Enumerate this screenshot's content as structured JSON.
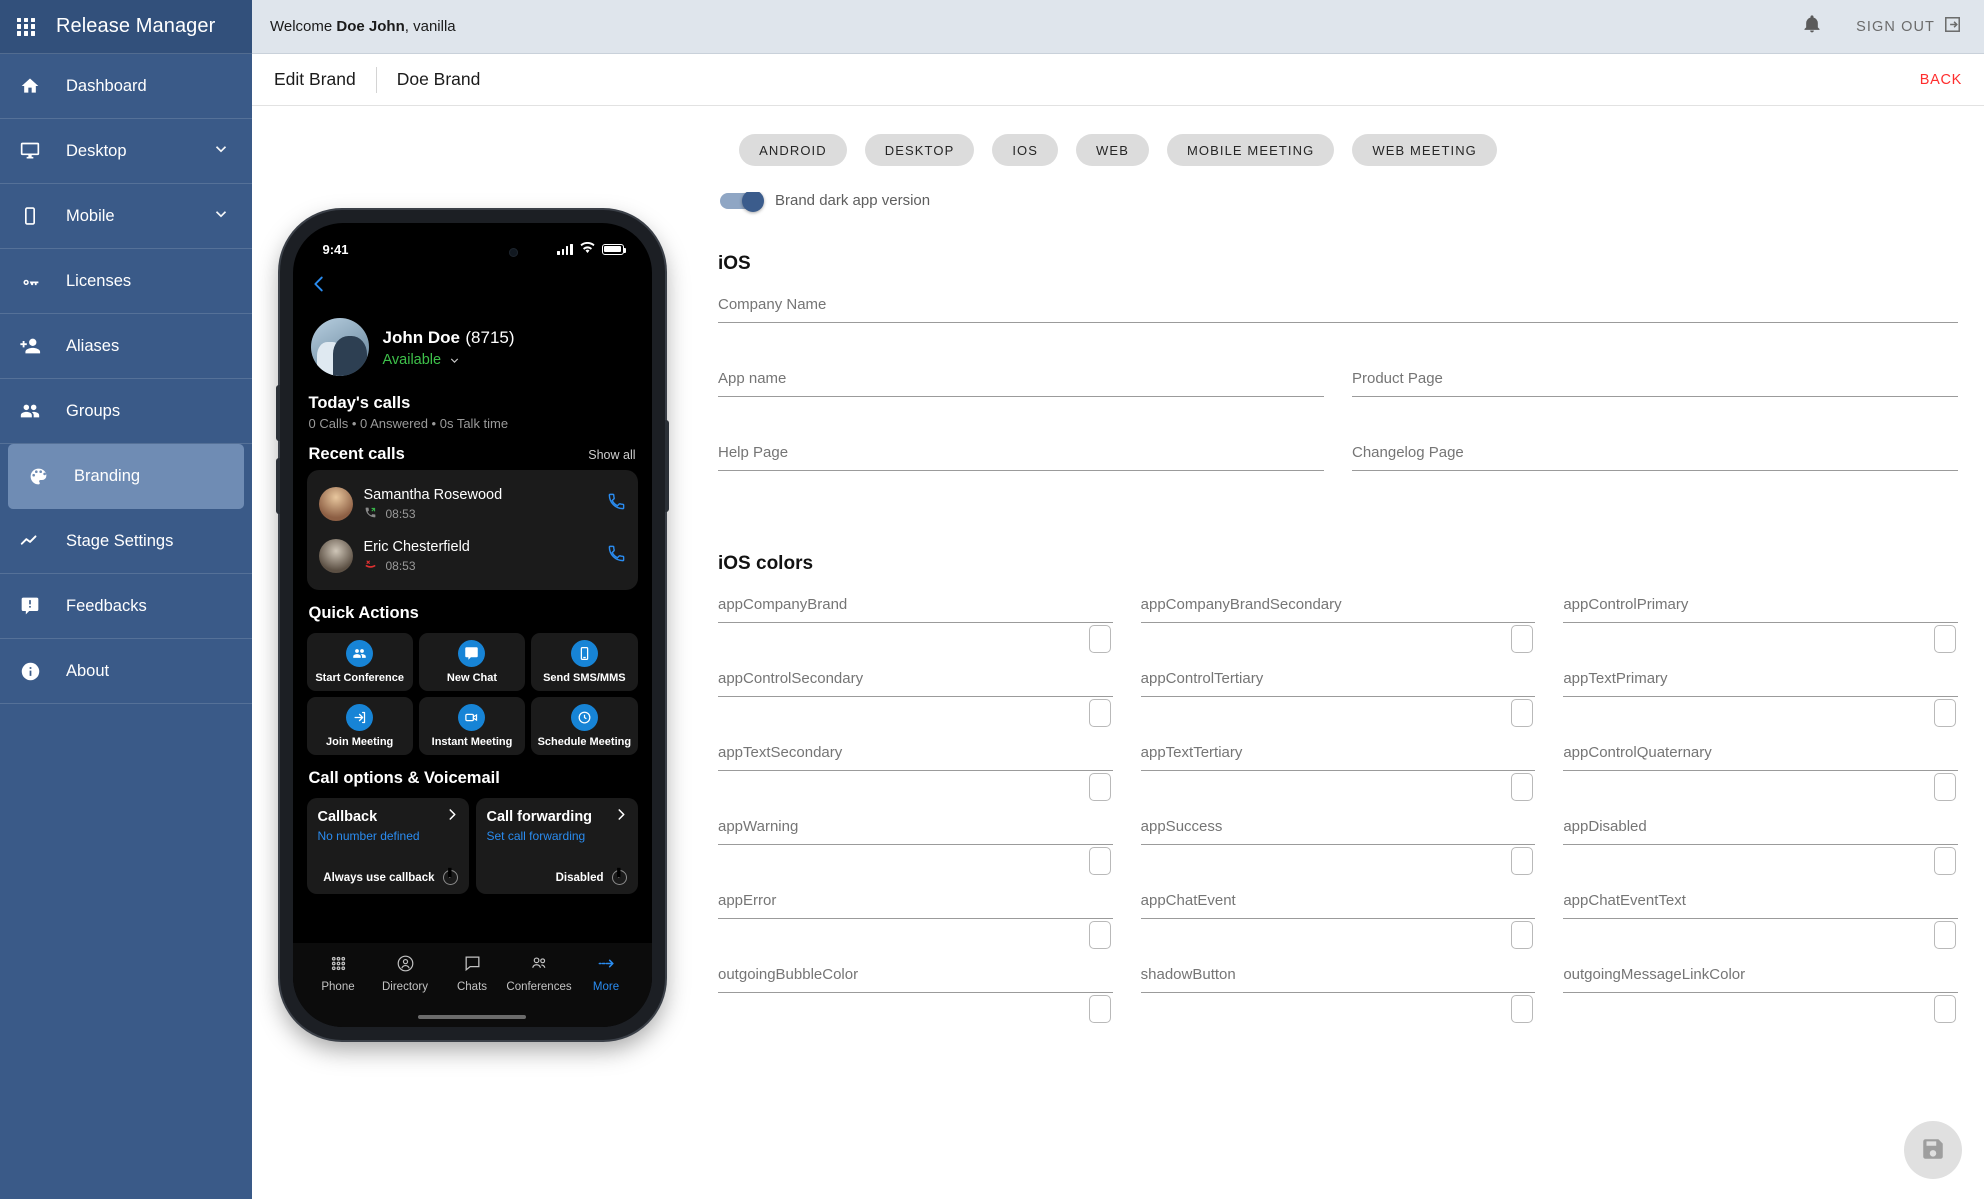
{
  "sidebar": {
    "brand": "Release Manager",
    "items": [
      {
        "label": "Dashboard",
        "icon": "home-icon",
        "chevron": false
      },
      {
        "label": "Desktop",
        "icon": "monitor-icon",
        "chevron": true
      },
      {
        "label": "Mobile",
        "icon": "phone-icon",
        "chevron": true
      },
      {
        "label": "Licenses",
        "icon": "key-icon",
        "chevron": false
      },
      {
        "label": "Aliases",
        "icon": "person-add-icon",
        "chevron": false
      },
      {
        "label": "Groups",
        "icon": "people-icon",
        "chevron": false
      },
      {
        "label": "Branding",
        "icon": "palette-icon",
        "chevron": false
      },
      {
        "label": "Stage Settings",
        "icon": "trending-icon",
        "chevron": false
      },
      {
        "label": "Feedbacks",
        "icon": "feedback-icon",
        "chevron": false
      },
      {
        "label": "About",
        "icon": "info-icon",
        "chevron": false
      }
    ],
    "active": "Branding"
  },
  "topbar": {
    "welcome_prefix": "Welcome",
    "user_name": "Doe John",
    "welcome_suffix": ", vanilla",
    "signout_label": "SIGN OUT"
  },
  "pagehead": {
    "title": "Edit Brand",
    "brand_name": "Doe Brand",
    "back_label": "BACK"
  },
  "tabs": [
    {
      "label": "ANDROID"
    },
    {
      "label": "DESKTOP"
    },
    {
      "label": "IOS"
    },
    {
      "label": "WEB"
    },
    {
      "label": "MOBILE MEETING"
    },
    {
      "label": "WEB MEETING"
    }
  ],
  "form": {
    "dark_toggle_label": "Brand dark app version",
    "dark_toggle_on": true,
    "section_ios": "iOS",
    "section_ios_colors": "iOS colors",
    "text_fields": [
      {
        "placeholder": "Company Name",
        "value": ""
      },
      {
        "placeholder": "App name",
        "value": ""
      },
      {
        "placeholder": "Product Page",
        "value": ""
      },
      {
        "placeholder": "Help Page",
        "value": ""
      },
      {
        "placeholder": "Changelog Page",
        "value": ""
      }
    ],
    "color_fields": [
      {
        "placeholder": "appCompanyBrand",
        "value": ""
      },
      {
        "placeholder": "appCompanyBrandSecondary",
        "value": ""
      },
      {
        "placeholder": "appControlPrimary",
        "value": ""
      },
      {
        "placeholder": "appControlSecondary",
        "value": ""
      },
      {
        "placeholder": "appControlTertiary",
        "value": ""
      },
      {
        "placeholder": "appTextPrimary",
        "value": ""
      },
      {
        "placeholder": "appTextSecondary",
        "value": ""
      },
      {
        "placeholder": "appTextTertiary",
        "value": ""
      },
      {
        "placeholder": "appControlQuaternary",
        "value": ""
      },
      {
        "placeholder": "appWarning",
        "value": ""
      },
      {
        "placeholder": "appSuccess",
        "value": ""
      },
      {
        "placeholder": "appDisabled",
        "value": ""
      },
      {
        "placeholder": "appError",
        "value": ""
      },
      {
        "placeholder": "appChatEvent",
        "value": ""
      },
      {
        "placeholder": "appChatEventText",
        "value": ""
      },
      {
        "placeholder": "outgoingBubbleColor",
        "value": ""
      },
      {
        "placeholder": "shadowButton",
        "value": ""
      },
      {
        "placeholder": "outgoingMessageLinkColor",
        "value": ""
      }
    ],
    "save_icon": "save-floppy-icon"
  },
  "preview": {
    "status_time": "9:41",
    "user_name": "John Doe",
    "user_ext": "(8715)",
    "presence": "Available",
    "todays_calls_title": "Today's calls",
    "todays_calls_sub": "0 Calls • 0 Answered • 0s Talk time",
    "recent_calls_title": "Recent calls",
    "show_all": "Show all",
    "calls": [
      {
        "name": "Samantha Rosewood",
        "time": "08:53",
        "type": "incoming"
      },
      {
        "name": "Eric Chesterfield",
        "time": "08:53",
        "type": "missed"
      }
    ],
    "quick_actions_title": "Quick Actions",
    "quick_actions": [
      {
        "label": "Start Conference",
        "icon": "group-icon"
      },
      {
        "label": "New Chat",
        "icon": "chat-bubble-icon"
      },
      {
        "label": "Send SMS/MMS",
        "icon": "sms-icon"
      },
      {
        "label": "Join Meeting",
        "icon": "login-arrow-icon"
      },
      {
        "label": "Instant Meeting",
        "icon": "video-camera-icon"
      },
      {
        "label": "Schedule Meeting",
        "icon": "clock-icon"
      }
    ],
    "call_options_title": "Call options & Voicemail",
    "call_options": [
      {
        "title": "Callback",
        "sub": "No number defined",
        "foot": "Always use callback"
      },
      {
        "title": "Call forwarding",
        "sub": "Set call forwarding",
        "foot": "Disabled"
      }
    ],
    "tabbar": [
      {
        "label": "Phone",
        "icon": "dialpad-icon",
        "active": false
      },
      {
        "label": "Directory",
        "icon": "contact-circle-icon",
        "active": false
      },
      {
        "label": "Chats",
        "icon": "chat-icon",
        "active": false
      },
      {
        "label": "Conferences",
        "icon": "group-icon",
        "active": false
      },
      {
        "label": "More",
        "icon": "arrow-right-icon",
        "active": true
      }
    ]
  },
  "colors": {
    "sidebar_bg": "#3a5a88",
    "sidebar_active": "#6f8cb4",
    "topbar_bg": "#dfe5ec",
    "accent_blue": "#1784d6",
    "back_red": "#ff2d2d",
    "presence_green": "#3ec04a"
  }
}
